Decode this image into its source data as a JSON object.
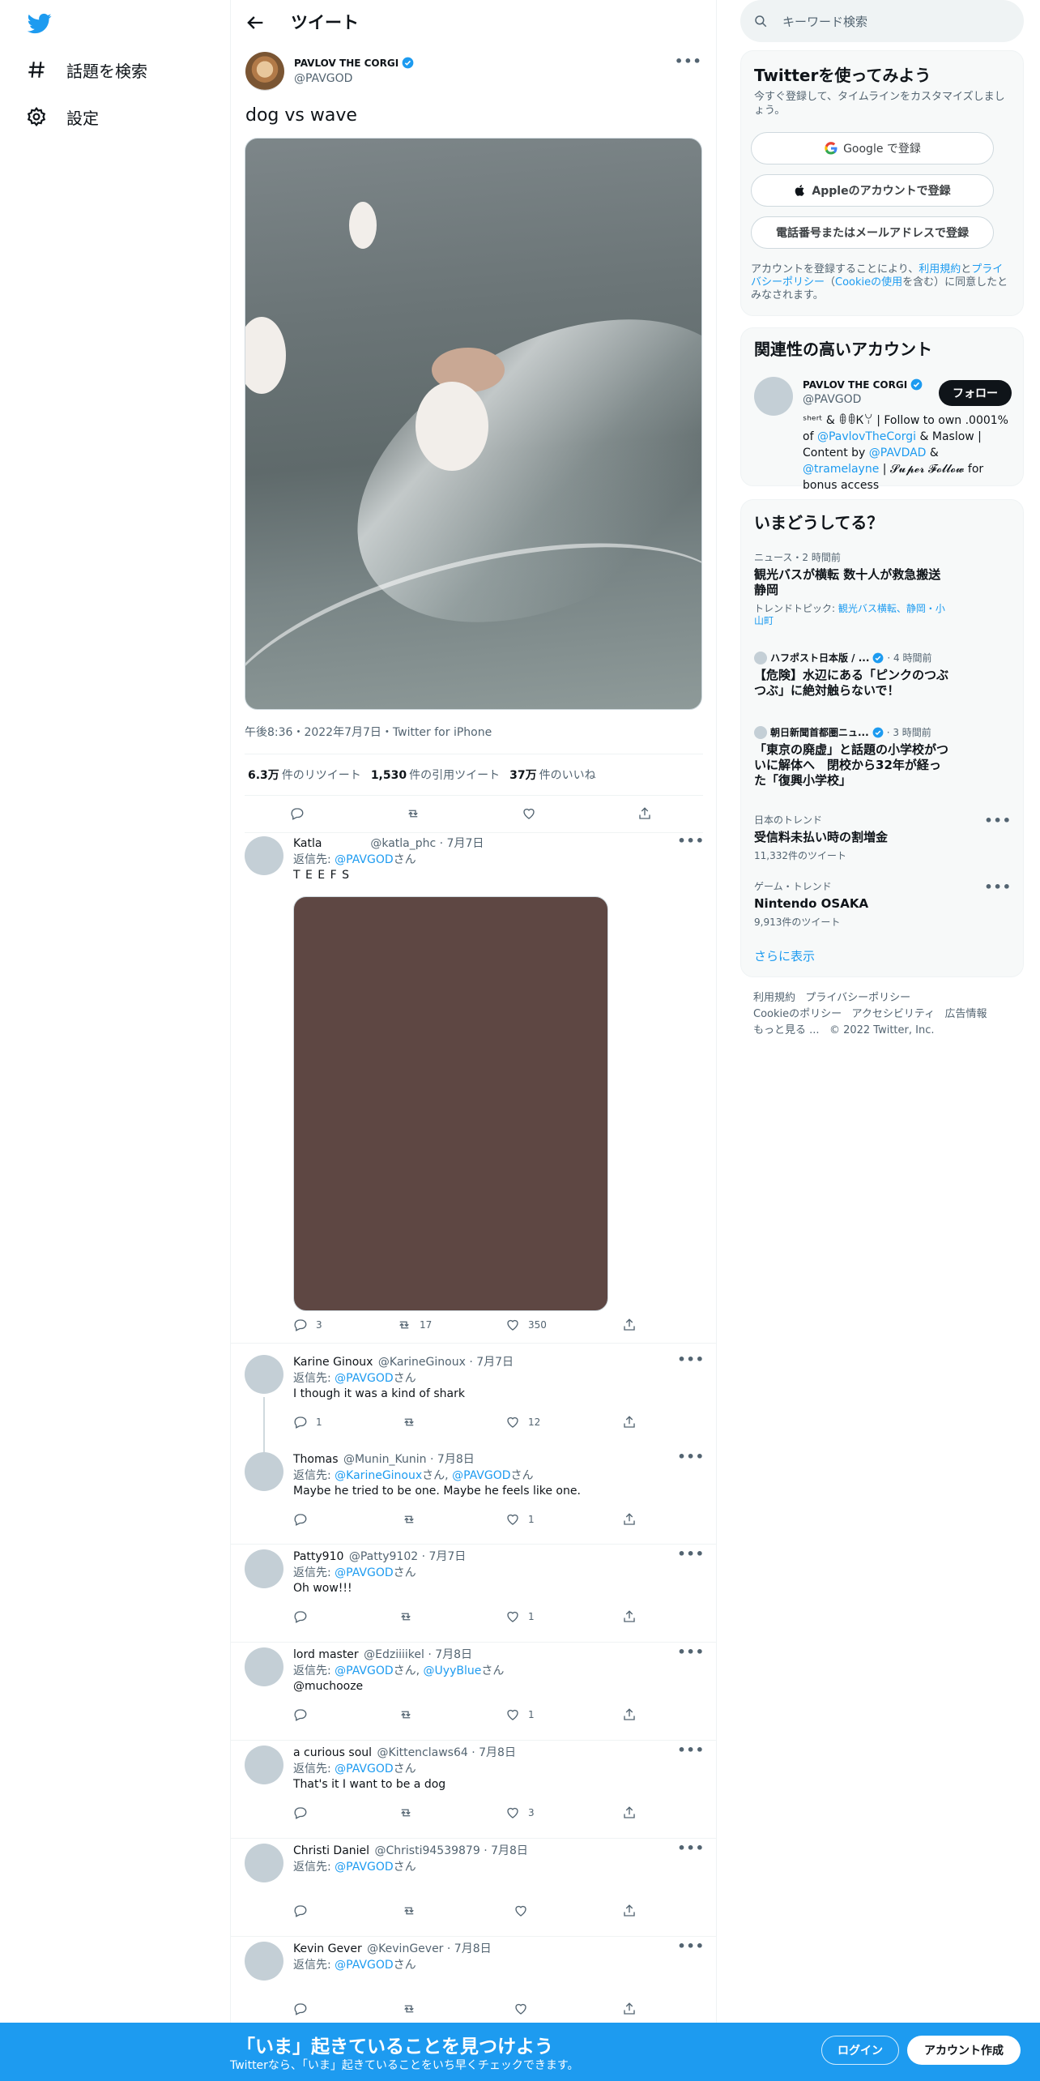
{
  "nav": {
    "items": [
      {
        "label": "話題を検索",
        "icon": "hashtag-icon"
      },
      {
        "label": "設定",
        "icon": "gear-icon"
      }
    ]
  },
  "header": {
    "title": "ツイート"
  },
  "main_tweet": {
    "name": "PAVLOV THE CORGI",
    "handle": "@PAVGOD",
    "text": "dog vs wave",
    "meta": "午後8:36・2022年7月7日・Twitter for iPhone",
    "retweets_count": "6.3万",
    "retweets_label": "件のリツイート",
    "quotes_count": "1,530",
    "quotes_label": "件の引用ツイート",
    "likes_count": "37万",
    "likes_label": "件のいいね"
  },
  "replies": [
    {
      "name": "Katla",
      "handle": "@katla_phc",
      "date": "· 7月7日",
      "to_prefix": "返信先: ",
      "to": "@PAVGOD",
      "to_suffix": "さん",
      "text": "T E E F S",
      "reply_count": "3",
      "rt_count": "17",
      "like_count": "350"
    },
    {
      "name": "Karine Ginoux",
      "handle": "@KarineGinoux",
      "date": "· 7月7日",
      "to_prefix": "返信先: ",
      "to": "@PAVGOD",
      "to_suffix": "さん",
      "text": "I though it was a kind of shark",
      "reply_count": "1",
      "rt_count": "",
      "like_count": "12"
    },
    {
      "name": "Thomas",
      "handle": "@Munin_Kunin",
      "date": "· 7月8日",
      "to_prefix": "返信先: ",
      "to": "@KarineGinoux",
      "to_mid": "さん, ",
      "to2": "@PAVGOD",
      "to_suffix": "さん",
      "text": "Maybe he tried to be one. Maybe he feels like one.",
      "reply_count": "",
      "rt_count": "",
      "like_count": "1"
    },
    {
      "name": "Patty910",
      "handle": "@Patty9102",
      "date": "· 7月7日",
      "to_prefix": "返信先: ",
      "to": "@PAVGOD",
      "to_suffix": "さん",
      "text": "Oh wow!!!",
      "reply_count": "",
      "rt_count": "",
      "like_count": "1"
    },
    {
      "name": "lord master",
      "handle": "@Edziiiikel",
      "date": "· 7月8日",
      "to_prefix": "返信先: ",
      "to": "@PAVGOD",
      "to_mid": "さん, ",
      "to2": "@UyyBlue",
      "to_suffix": "さん",
      "to3": "@muchooze",
      "text": "",
      "reply_count": "",
      "rt_count": "",
      "like_count": "1"
    },
    {
      "name": "a curious soul",
      "handle": "@Kittenclaws64",
      "date": "· 7月8日",
      "to_prefix": "返信先: ",
      "to": "@PAVGOD",
      "to_suffix": "さん",
      "text": "That's it I want to be a dog",
      "reply_count": "",
      "rt_count": "",
      "like_count": "3"
    },
    {
      "name": "Christi Daniel",
      "handle": "@Christi94539879",
      "date": "· 7月8日",
      "to_prefix": "返信先: ",
      "to": "@PAVGOD",
      "to_suffix": "さん",
      "text": "",
      "reply_count": "",
      "rt_count": "",
      "like_count": ""
    },
    {
      "name": "Kevin Gever",
      "handle": "@KevinGever",
      "date": "· 7月8日",
      "to_prefix": "返信先: ",
      "to": "@PAVGOD",
      "to_suffix": "さん",
      "text": "",
      "reply_count": "",
      "rt_count": "",
      "like_count": ""
    }
  ],
  "search": {
    "placeholder": "キーワード検索"
  },
  "signup": {
    "title": "Twitterを使ってみよう",
    "desc": "今すぐ登録して、タイムラインをカスタマイズしましょう。",
    "google": "Google で登録",
    "apple": "Appleのアカウントで登録",
    "phone": "電話番号またはメールアドレスで登録",
    "legal_1": "アカウントを登録することにより、",
    "legal_terms": "利用規約",
    "legal_2": "と",
    "legal_privacy": "プライバシーポリシー",
    "legal_3": "（",
    "legal_cookie": "Cookieの使用",
    "legal_4": "を含む）に同意したとみなされます。"
  },
  "related": {
    "title": "関連性の高いアカウント",
    "name": "PAVLOV THE CORGI",
    "handle": "@PAVGOD",
    "follow": "フォロー",
    "bio_1": "ˢʰᵉʳᵗ & ꂦꂦᏦꌩ | Follow to own .0001% of ",
    "bio_link1": "@PavlovTheCorgi",
    "bio_2": " & Maslow | Content by ",
    "bio_link2": "@PAVDAD",
    "bio_3": " & ",
    "bio_link3": "@tramelayne",
    "bio_4": " | 𝓢𝓾𝓹𝓮𝓻 𝓕𝓸𝓵𝓵𝓸𝔀 for bonus access"
  },
  "trends": {
    "title": "いまどうしてる？",
    "items": [
      {
        "meta": "ニュース・2 時間前",
        "title": "観光バスが横転 数十人が救急搬送 静岡",
        "sub_prefix": "トレンドトピック: ",
        "sub_link": "観光バス横転、静岡・小山町"
      },
      {
        "meta": "ハフポスト日本版 / ...",
        "meta_time": "· 4 時間前",
        "title": "【危険】水辺にある「ピンクのつぶつぶ」に絶対触らないで！"
      },
      {
        "meta": "朝日新聞首都圏ニュ...",
        "meta_time": "· 3 時間前",
        "title": "「東京の廃虚」と話題の小学校がついに解体へ　閉校から32年が経った「復興小学校」"
      },
      {
        "meta": "日本のトレンド",
        "title": "受信料未払い時の割増金",
        "sub": "11,332件のツイート"
      },
      {
        "meta": "ゲーム・トレンド",
        "title": "Nintendo OSAKA",
        "sub": "9,913件のツイート"
      }
    ],
    "show_more": "さらに表示"
  },
  "footer": {
    "terms": "利用規約",
    "privacy": "プライバシーポリシー",
    "cookie": "Cookieのポリシー",
    "accessibility": "アクセシビリティ",
    "ads": "広告情報",
    "more": "もっと見る ...",
    "copyright": "© 2022 Twitter, Inc."
  },
  "bottom_bar": {
    "title": "「いま」起きていることを見つけよう",
    "sub": "Twitterなら、「いま」起きていることをいち早くチェックできます。",
    "login": "ログイン",
    "signup": "アカウント作成"
  },
  "colors": {
    "brand": "#1d9bf0",
    "text": "#0f1419",
    "secondary": "#536471"
  }
}
